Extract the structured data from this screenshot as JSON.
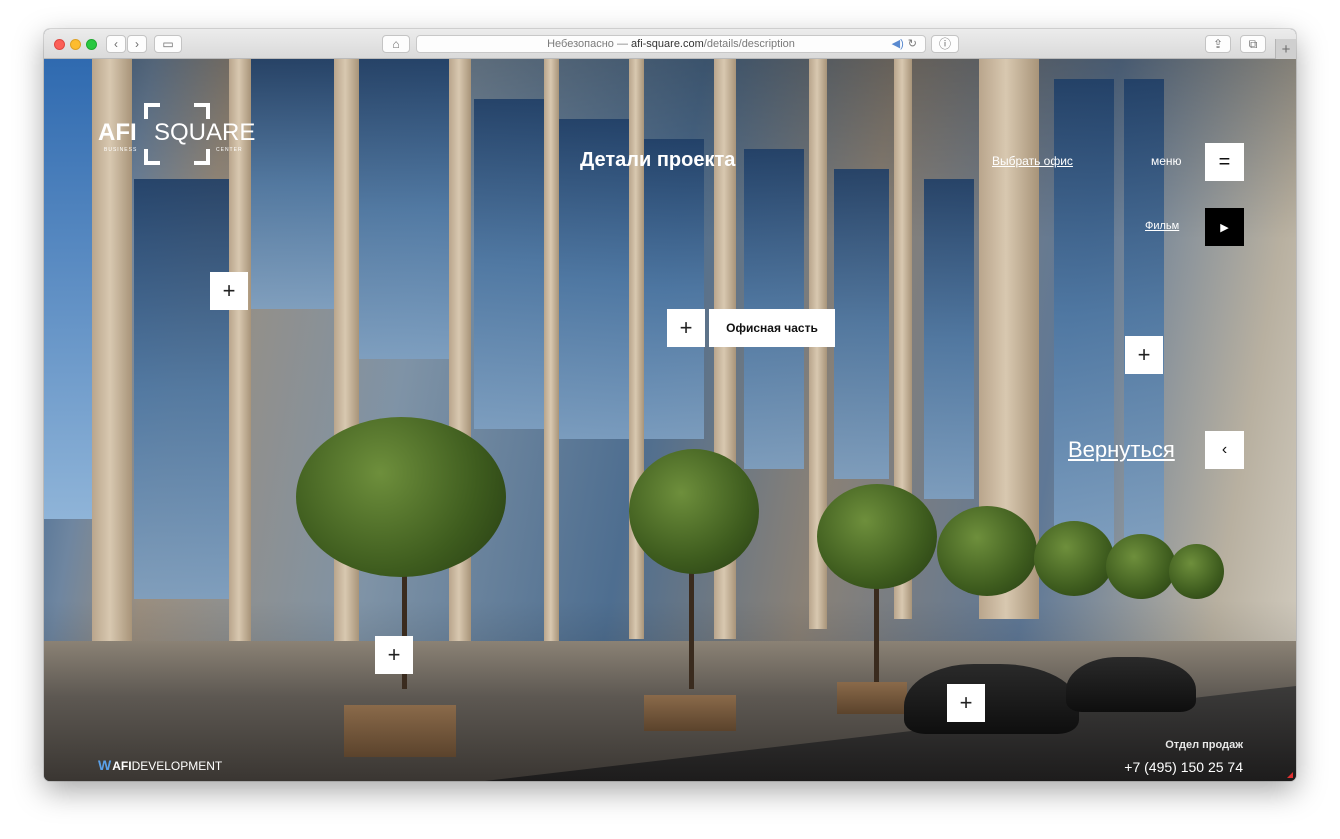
{
  "browser": {
    "url_prefix": "Небезопасно —",
    "url_host": "afi-square.com",
    "url_path": "/details/description",
    "new_tab_label": "+"
  },
  "header": {
    "logo_afi": "AFI",
    "logo_square": "SQUARE",
    "logo_business": "BUSINESS",
    "logo_center": "CENTER",
    "page_title": "Детали проекта",
    "select_office": "Выбрать офис",
    "menu_label": "меню",
    "film_link": "Фильм"
  },
  "nav": {
    "back_label": "Вернуться"
  },
  "hotspots": {
    "office_part_label": "Офисная часть"
  },
  "footer": {
    "developer_logo_bold": "AFI",
    "developer_logo_rest": "DEVELOPMENT",
    "sales_label": "Отдел продаж",
    "sales_phone": "+7 (495) 150 25 74"
  },
  "colors": {
    "overlay_text": "#ffffff",
    "button_bg": "#ffffff",
    "film_button_bg": "#000000",
    "developer_accent": "#5aa0e8"
  }
}
